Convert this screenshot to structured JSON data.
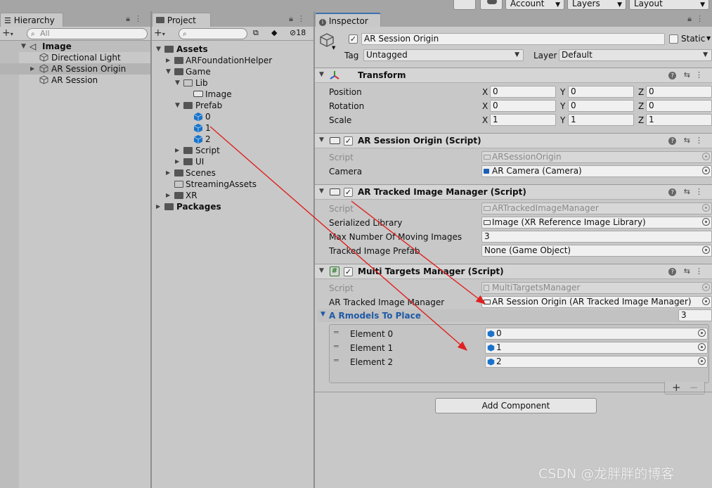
{
  "toolbar": {
    "account_label": "Account",
    "layers_label": "Layers",
    "layout_label": "Layout"
  },
  "hierarchy": {
    "tab_label": "Hierarchy",
    "search_placeholder": "All",
    "scene_name": "Image",
    "items": [
      {
        "label": "Directional Light"
      },
      {
        "label": "AR Session Origin"
      },
      {
        "label": "AR Session"
      }
    ]
  },
  "project": {
    "tab_label": "Project",
    "hidden_count": "18",
    "tree": {
      "assets": "Assets",
      "arfoundationhelper": "ARFoundationHelper",
      "game": "Game",
      "lib": "Lib",
      "lib_image": "Image",
      "prefab": "Prefab",
      "prefab_0": "0",
      "prefab_1": "1",
      "prefab_2": "2",
      "script": "Script",
      "ui": "UI",
      "scenes": "Scenes",
      "streamingassets": "StreamingAssets",
      "xr": "XR",
      "packages": "Packages"
    }
  },
  "inspector": {
    "tab_label": "Inspector",
    "object_name": "AR Session Origin",
    "static_label": "Static",
    "tag_label": "Tag",
    "tag_value": "Untagged",
    "layer_label": "Layer",
    "layer_value": "Default",
    "transform": {
      "title": "Transform",
      "position_label": "Position",
      "rotation_label": "Rotation",
      "scale_label": "Scale",
      "axis_x": "X",
      "axis_y": "Y",
      "axis_z": "Z",
      "position": [
        "0",
        "0",
        "0"
      ],
      "rotation": [
        "0",
        "0",
        "0"
      ],
      "scale": [
        "1",
        "1",
        "1"
      ]
    },
    "ar_session_origin": {
      "title": "AR Session Origin (Script)",
      "script_label": "Script",
      "script_value": "ARSessionOrigin",
      "camera_label": "Camera",
      "camera_value": "AR Camera (Camera)"
    },
    "ar_tracked_image_manager": {
      "title": "AR Tracked Image Manager (Script)",
      "script_label": "Script",
      "script_value": "ARTrackedImageManager",
      "serialized_library_label": "Serialized Library",
      "serialized_library_value": "Image (XR Reference Image Library)",
      "max_moving_label": "Max Number Of Moving Images",
      "max_moving_value": "3",
      "prefab_label": "Tracked Image Prefab",
      "prefab_value": "None (Game Object)"
    },
    "multi_targets_manager": {
      "title": "Multi Targets Manager (Script)",
      "script_label": "Script",
      "script_value": "MultiTargetsManager",
      "tracked_manager_label": "AR Tracked Image Manager",
      "tracked_manager_value": "AR Session Origin (AR Tracked Image Manager)",
      "list_label": "A Rmodels To Place",
      "list_size": "3",
      "elements": [
        {
          "label": "Element 0",
          "value": "0"
        },
        {
          "label": "Element 1",
          "value": "1"
        },
        {
          "label": "Element 2",
          "value": "2"
        }
      ],
      "add_symbol": "+",
      "remove_symbol": "−"
    },
    "add_component_label": "Add Component"
  },
  "watermark": "CSDN @龙胖胖的博客",
  "colors": {
    "panel_bg": "#c8c8c8",
    "field_bg": "#f0f0f0",
    "selection": "#b3b3b3",
    "prefab_blue": "#1a73c9",
    "annotation_red": "#e02020",
    "list_header_blue": "#1f5aa6"
  }
}
